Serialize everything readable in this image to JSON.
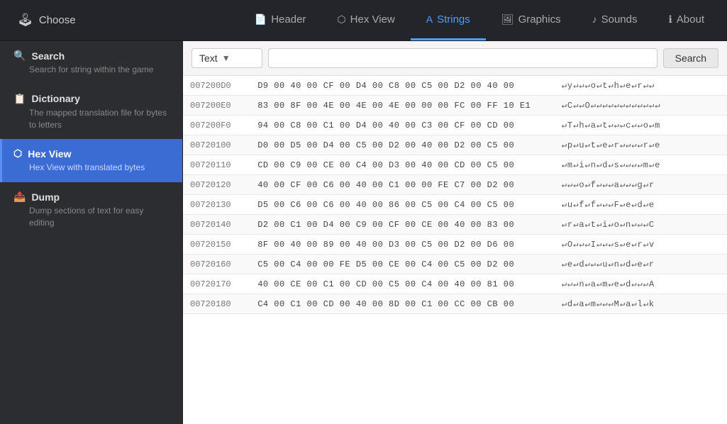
{
  "nav": {
    "choose_label": "Choose",
    "choose_icon": "joystick-icon",
    "tabs": [
      {
        "id": "header",
        "label": "Header",
        "icon": "📄",
        "active": false
      },
      {
        "id": "hex-view",
        "label": "Hex View",
        "icon": "⬡",
        "active": false
      },
      {
        "id": "strings",
        "label": "Strings",
        "icon": "A",
        "active": true
      },
      {
        "id": "graphics",
        "label": "Graphics",
        "icon": "🖼",
        "active": false
      },
      {
        "id": "sounds",
        "label": "Sounds",
        "icon": "♪",
        "active": false
      },
      {
        "id": "about",
        "label": "About",
        "icon": "ℹ",
        "active": false
      }
    ]
  },
  "sidebar": {
    "items": [
      {
        "id": "search",
        "icon": "🔍",
        "label": "Search",
        "desc": "Search for string within the game",
        "active": false
      },
      {
        "id": "dictionary",
        "icon": "📋",
        "label": "Dictionary",
        "desc": "The mapped translation file for bytes to letters",
        "active": false
      },
      {
        "id": "hex-view",
        "icon": "⬡",
        "label": "Hex View",
        "desc": "Hex View with translated bytes",
        "active": true
      },
      {
        "id": "dump",
        "icon": "📤",
        "label": "Dump",
        "desc": "Dump sections of text for easy editing",
        "active": false
      }
    ]
  },
  "search_bar": {
    "type_label": "Text",
    "placeholder": "",
    "search_btn": "Search"
  },
  "hex_rows": [
    {
      "addr": "007200D0",
      "hex": "D9 00 40 00 CF 00 D4 00 C8 00 C5 00 D2 00 40 00",
      "text": "↵y↵↵↵o↵t↵h↵e↵r↵↵"
    },
    {
      "addr": "007200E0",
      "hex": "83 00 8F 00 4E 00 4E 00 4E 00 00 00 FC 00 FF 10 E1",
      "text": "↵C↵↵O↵↵↵↵↵↵↵↵↵↵↵↵"
    },
    {
      "addr": "007200F0",
      "hex": "94 00 C8 00 C1 00 D4 00 40 00 C3 00 CF 00 CD 00",
      "text": "↵T↵h↵a↵t↵↵↵c↵↵o↵m"
    },
    {
      "addr": "00720100",
      "hex": "D0 00 D5 00 D4 00 C5 00 D2 00 40 00 D2 00 C5 00",
      "text": "↵p↵u↵t↵e↵r↵↵↵↵r↵e"
    },
    {
      "addr": "00720110",
      "hex": "CD 00 C9 00 CE 00 C4 00 D3 00 40 00 CD 00 C5 00",
      "text": "↵m↵i↵n↵d↵s↵↵↵↵m↵e"
    },
    {
      "addr": "00720120",
      "hex": "40 00 CF 00 C6 00 40 00 C1 00 00 FE C7 00 D2 00",
      "text": "↵↵↵o↵f↵↵↵a↵↵↵g↵r"
    },
    {
      "addr": "00720130",
      "hex": "D5 00 C6 00 C6 00 40 00 86 00 C5 00 C4 00 C5 00",
      "text": "↵u↵f↵f↵↵↵F↵e↵d↵e"
    },
    {
      "addr": "00720140",
      "hex": "D2 00 C1 00 D4 00 C9 00 CF 00 CE 00 40 00 83 00",
      "text": "↵r↵a↵t↵i↵o↵n↵↵↵C"
    },
    {
      "addr": "00720150",
      "hex": "8F 00 40 00 89 00 40 00 D3 00 C5 00 D2 00 D6 00",
      "text": "↵O↵↵↵I↵↵↵s↵e↵r↵v"
    },
    {
      "addr": "00720160",
      "hex": "C5 00 C4 00 00 FE D5 00 CE 00 C4 00 C5 00 D2 00",
      "text": "↵e↵d↵↵↵u↵n↵d↵e↵r"
    },
    {
      "addr": "00720170",
      "hex": "40 00 CE 00 C1 00 CD 00 C5 00 C4 00 40 00 81 00",
      "text": "↵↵↵n↵a↵m↵e↵d↵↵↵A"
    },
    {
      "addr": "00720180",
      "hex": "C4 00 C1 00 CD 00 40 00 8D 00 C1 00 CC 00 CB 00",
      "text": "↵d↵a↵m↵↵↵M↵a↵l↵k"
    }
  ]
}
